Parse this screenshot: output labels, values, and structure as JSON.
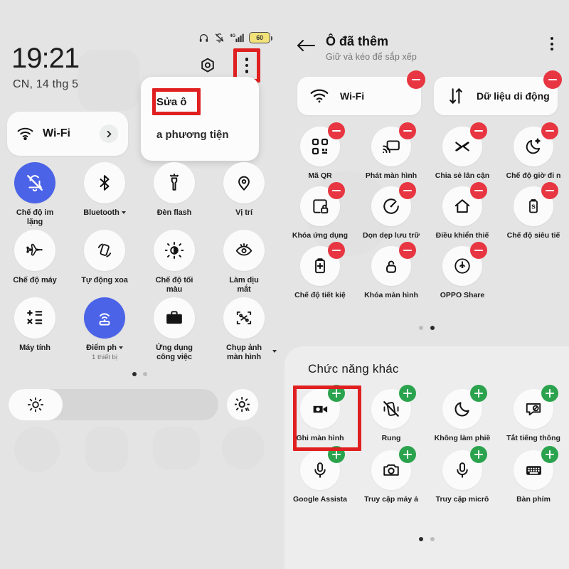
{
  "left": {
    "statusbar": {
      "icons": [
        "headphones-icon",
        "bell-muted-icon",
        "signal-4g-icon"
      ],
      "battery_level": "60"
    },
    "clock": "19:21",
    "date": "CN, 14 thg 5",
    "gear_icon": "gear-icon",
    "kebab_icon": "more-vertical-icon",
    "wifi_card": {
      "label": "Wi-Fi",
      "icon": "wifi-icon",
      "chevron": "chevron-right-icon"
    },
    "popup_menu": {
      "items": [
        {
          "label": "Sửa ô",
          "highlighted": true
        },
        {
          "label": "a phương tiện",
          "highlighted": false
        }
      ]
    },
    "tiles": [
      {
        "label": "Chế độ im\nlặng",
        "icon": "bell-off-icon",
        "active": true,
        "caret": false,
        "sub": ""
      },
      {
        "label": "Bluetooth",
        "icon": "bluetooth-icon",
        "active": false,
        "caret": true,
        "sub": ""
      },
      {
        "label": "Đèn flash",
        "icon": "flashlight-icon",
        "active": false,
        "caret": false,
        "sub": ""
      },
      {
        "label": "Vị trí",
        "icon": "location-icon",
        "active": false,
        "caret": false,
        "sub": ""
      },
      {
        "label": "Chế độ máy",
        "icon": "airplane-icon",
        "active": false,
        "caret": false,
        "sub": ""
      },
      {
        "label": "Tự động xoa",
        "icon": "auto-rotate-icon",
        "active": false,
        "caret": false,
        "sub": ""
      },
      {
        "label": "Chế độ tối\nmàu",
        "icon": "dark-mode-icon",
        "active": false,
        "caret": false,
        "sub": ""
      },
      {
        "label": "Làm dịu\nmắt",
        "icon": "eye-comfort-icon",
        "active": false,
        "caret": false,
        "sub": ""
      },
      {
        "label": "Máy tính",
        "icon": "calculator-icon",
        "active": false,
        "caret": false,
        "sub": ""
      },
      {
        "label": "Điểm ph",
        "icon": "hotspot-icon",
        "active": true,
        "caret": true,
        "sub": "1 thiết bị"
      },
      {
        "label": "Ứng dụng\ncông việc",
        "icon": "briefcase-icon",
        "active": false,
        "caret": false,
        "sub": ""
      },
      {
        "label": "Chụp ảnh\nmàn hình",
        "icon": "screenshot-icon",
        "active": false,
        "caret": false,
        "sub": "",
        "caret_far": true
      }
    ],
    "page_dots": {
      "count": 2,
      "active_index": 0
    },
    "brightness": {
      "icon": "brightness-icon",
      "auto_icon": "brightness-auto-icon",
      "value_percent": 26
    }
  },
  "right": {
    "header": {
      "back_icon": "arrow-left-icon",
      "title": "Ô đã thêm",
      "subtitle": "Giữ và kéo để sắp xếp",
      "kebab_icon": "more-vertical-icon"
    },
    "wide_tiles": [
      {
        "label": "Wi-Fi",
        "icon": "wifi-icon",
        "badge": "minus"
      },
      {
        "label": "Dữ liệu di động",
        "icon": "data-transfer-icon",
        "badge": "minus"
      }
    ],
    "added_tiles": [
      {
        "label": "Mã QR",
        "icon": "qr-code-icon",
        "badge": "minus"
      },
      {
        "label": "Phát màn hình",
        "icon": "cast-icon",
        "badge": "minus"
      },
      {
        "label": "Chia sẻ lân cận",
        "icon": "nearby-share-icon",
        "badge": "minus"
      },
      {
        "label": "Chế độ giờ đi n",
        "icon": "bedtime-icon",
        "badge": "minus"
      },
      {
        "label": "Khóa ứng dụng",
        "icon": "app-lock-icon",
        "badge": "minus"
      },
      {
        "label": "Dọn dẹp lưu trữ",
        "icon": "storage-clean-icon",
        "badge": "minus"
      },
      {
        "label": "Điều khiển thiế",
        "icon": "home-control-icon",
        "badge": "minus"
      },
      {
        "label": "Chế độ siêu tiế",
        "icon": "super-saver-icon",
        "badge": "minus"
      },
      {
        "label": "Chế độ tiết kiệ",
        "icon": "battery-saver-icon",
        "badge": "minus"
      },
      {
        "label": "Khóa màn hình",
        "icon": "screen-lock-icon",
        "badge": "minus"
      },
      {
        "label": "OPPO Share",
        "icon": "oppo-share-icon",
        "badge": "minus"
      }
    ],
    "added_page_dots": {
      "count": 2,
      "active_index": 1
    },
    "other": {
      "title": "Chức năng khác",
      "tiles": [
        {
          "label": "Ghi màn hình",
          "icon": "screen-record-icon",
          "badge": "plus",
          "highlighted": true
        },
        {
          "label": "Rung",
          "icon": "vibrate-off-icon",
          "badge": "plus",
          "highlighted": false
        },
        {
          "label": "Không làm phiề",
          "icon": "moon-icon",
          "badge": "plus",
          "highlighted": false
        },
        {
          "label": "Tắt tiếng thông",
          "icon": "mute-notify-icon",
          "badge": "plus",
          "highlighted": false
        },
        {
          "label": "Google Assista",
          "icon": "microphone-icon",
          "badge": "plus",
          "highlighted": false
        },
        {
          "label": "Truy cập máy ả",
          "icon": "camera-icon",
          "badge": "plus",
          "highlighted": false
        },
        {
          "label": "Truy cập micrô",
          "icon": "microphone-icon",
          "badge": "plus",
          "highlighted": false
        },
        {
          "label": "Bàn phím",
          "icon": "keyboard-icon",
          "badge": "plus",
          "highlighted": false
        }
      ],
      "page_dots": {
        "count": 2,
        "active_index": 0
      }
    }
  },
  "colors": {
    "background": "#e4e4e4",
    "accent_blue": "#4a63e7",
    "badge_remove_red": "#e73641",
    "badge_add_green": "#2ba34e",
    "highlight_red": "#e02020",
    "tile_white": "#fbfbfb"
  }
}
